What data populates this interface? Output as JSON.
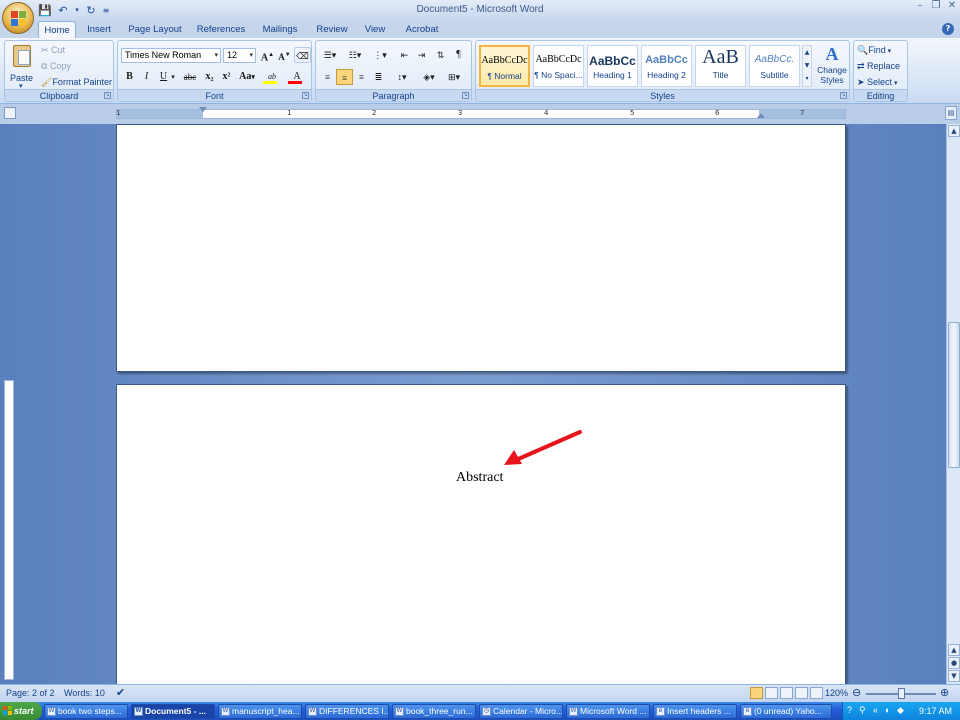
{
  "window": {
    "title": "Document5 - Microsoft Word",
    "controls": [
      "–",
      "❐",
      "✕"
    ]
  },
  "tabs": [
    {
      "label": "Home",
      "active": true
    },
    {
      "label": "Insert"
    },
    {
      "label": "Page Layout"
    },
    {
      "label": "References"
    },
    {
      "label": "Mailings"
    },
    {
      "label": "Review"
    },
    {
      "label": "View"
    },
    {
      "label": "Acrobat"
    }
  ],
  "clipboard": {
    "label": "Clipboard",
    "paste": "Paste",
    "cut": "Cut",
    "copy": "Copy",
    "format_painter": "Format Painter"
  },
  "font": {
    "label": "Font",
    "family": "Times New Roman",
    "size": "12",
    "buttons": {
      "bold": "B",
      "italic": "I",
      "underline": "U",
      "strike": "abc",
      "subscript": "x₂",
      "superscript": "x²",
      "change_case": "Aa",
      "grow": "A",
      "shrink": "A",
      "highlight": "ab",
      "color": "A"
    }
  },
  "paragraph": {
    "label": "Paragraph"
  },
  "styles": {
    "label": "Styles",
    "items": [
      {
        "sample": "AaBbCcDc",
        "name": "¶ Normal",
        "active": true
      },
      {
        "sample": "AaBbCcDc",
        "name": "¶ No Spaci..."
      },
      {
        "sample": "AaBbCc",
        "name": "Heading 1"
      },
      {
        "sample": "AaBbCc",
        "name": "Heading 2"
      },
      {
        "sample": "AaB",
        "name": "Title"
      },
      {
        "sample": "AaBbCc.",
        "name": "Subtitle"
      }
    ],
    "change_styles_1": "Change",
    "change_styles_2": "Styles"
  },
  "editing": {
    "label": "Editing",
    "find": "Find",
    "replace": "Replace",
    "select": "Select"
  },
  "ruler": {
    "numbers": [
      "1",
      "1",
      "2",
      "3",
      "4",
      "5",
      "6",
      "7"
    ]
  },
  "document": {
    "text": "Abstract"
  },
  "status": {
    "page": "Page: 2 of 2",
    "words": "Words: 10",
    "zoom": "120%",
    "zoom_fraction": 0.5
  },
  "taskbar": {
    "start": "start",
    "tasks": [
      {
        "label": "book two steps..."
      },
      {
        "label": "Document5 - ...",
        "active": true
      },
      {
        "label": "manuscript_hea..."
      },
      {
        "label": "DIFFERENCES I..."
      },
      {
        "label": "book_three_run..."
      },
      {
        "label": "Calendar - Micro..."
      },
      {
        "label": "Microsoft Word ..."
      },
      {
        "label": "Insert headers ..."
      },
      {
        "label": "(0 unread) Yaho..."
      }
    ],
    "clock": "9:17 AM"
  },
  "colors": {
    "accent": "#15428b",
    "arrow": "#e8141c",
    "highlight_bar": "#ffff00",
    "font_color_bar": "#ff0000"
  }
}
